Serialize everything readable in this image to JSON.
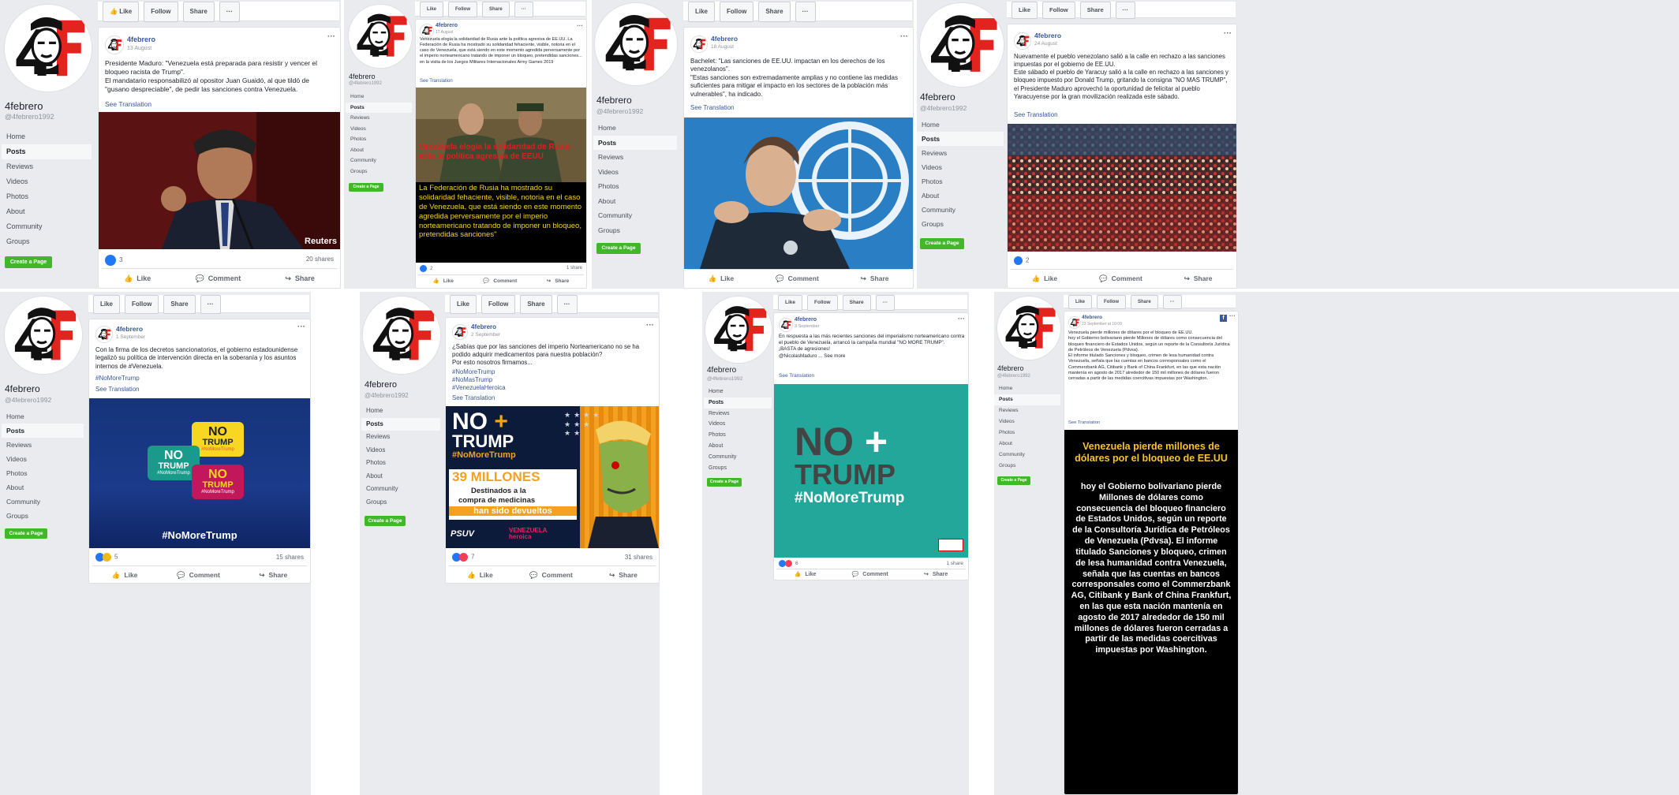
{
  "page": {
    "name": "4febrero",
    "handle": "@4febrero1992",
    "logo_text": "4F"
  },
  "toolbar": {
    "like": "Like",
    "follow": "Follow",
    "share": "Share",
    "more": "···"
  },
  "nav": [
    "Home",
    "Posts",
    "Reviews",
    "Videos",
    "Photos",
    "About",
    "Community",
    "Groups"
  ],
  "create_page": "Create a Page",
  "actions": {
    "like": "Like",
    "comment": "Comment",
    "share": "Share"
  },
  "posts": [
    {
      "author": "4febrero",
      "date": "13 August",
      "text": "Presidente Maduro: \"Venezuela está preparada para resistir y vencer el bloqueo racista de Trump\".\nEl mandatario responsabilizó al opositor Juan Guaidó, al que tildó de \"gusano despreciable\", de pedir las sanciones contra Venezuela.",
      "see_translation": "See Translation",
      "image_credit": "Reuters",
      "reactions": "3",
      "shares": "20 shares"
    },
    {
      "author": "4febrero",
      "date": "17 August",
      "text": "Venezuela elogia la solidaridad de Rusia ante la política agresiva de EE.UU. La Federación de Rusia ha mostrado su solidaridad fehaciente, visible, notoria en el caso de Venezuela, que está siendo en este momento agredida perversamente por el imperio norteamericano tratando de imponer un bloqueo, pretendidas sanciones... en la visita de los Juegos Militares Internacionales Army Games 2019",
      "see_translation": "See Translation",
      "image_title": "Venezuela elogia la solidaridad de Rusia ante la política agresiva de EEUU",
      "image_body": "La Federación de Rusia ha mostrado su solidaridad fehaciente, visible, notoria en el caso de Venezuela, que está siendo en este momento agredida perversamente por el imperio norteamericano tratando de imponer un bloqueo, pretendidas sanciones\"",
      "reactions": "2",
      "shares": "1 share"
    },
    {
      "author": "4febrero",
      "date": "18 August",
      "text": "Bachelet: \"Las sanciones de EE.UU. impactan en los derechos de los venezolanos\".\n\"Estas sanciones son extremadamente amplias y no contiene las medidas suficientes para mitigar el impacto en los sectores de la población más vulnerables\", ha indicado.",
      "see_translation": "See Translation"
    },
    {
      "author": "4febrero",
      "date": "24 August",
      "text": "Nuevamente el pueblo venezolano salió a la calle en rechazo a las sanciones impuestas por el gobierno de EE.UU.\nEste sábado el pueblo de Yaracuy salió a la calle en rechazo a las sanciones y bloqueo impuesto por Donald Trump, gritando la consigna \"NO MAS TRUMP\", el Presidente Maduro aprovechó la oportunidad de felicitar al pueblo Yaracuyense por la gran movilización realizada este sábado.",
      "see_translation": "See Translation",
      "reactions": "2"
    },
    {
      "author": "4febrero",
      "date": "1 September",
      "text": "Con la firma de los decretos sancionatorios, el gobierno estadounidense legalizó su política de intervención directa en la soberanía y los asuntos internos de #Venezuela.",
      "hashtag": "#NoMoreTrump",
      "see_translation": "See Translation",
      "image_tag": "#NoMoreTrump",
      "bubble_no": "NO",
      "bubble_trump": "TRUMP",
      "bubble_tag": "#NoMoreTrump",
      "reactions": "5",
      "shares": "15 shares"
    },
    {
      "author": "4febrero",
      "date": "2 September",
      "text": "¿Sabías que por las sanciones del imperio Norteamericano no se ha podido adquirir medicamentos para nuestra población?\nPor esto nosotros firmamos...",
      "hashtags": [
        "#NoMoreTrump",
        "#NoMasTrump",
        "#VenezuelaHeroica"
      ],
      "see_translation": "See Translation",
      "img_no": "NO",
      "img_trump": "TRUMP",
      "img_tag": "#NoMoreTrump",
      "img_millones": "39 MILLONES",
      "img_dest1": "Destinados a la",
      "img_dest2": "compra de medicinas",
      "img_devueltos": "han sido devueltos",
      "img_psuv": "PSUV",
      "img_vh": "VENEZUELA heroica",
      "reactions": "7",
      "shares": "31 shares"
    },
    {
      "author": "4febrero",
      "date": "3 September",
      "text": "En respuesta a las más recientes sanciones del imperialismo norteamericano contra el pueblo de Venezuela, arrancó la campaña mundial \"NO MORE TRUMP\".\n¡BASTA de agresiones!\n@NicolasMaduro ... See more",
      "see_translation": "See Translation",
      "img_no": "NO",
      "img_trump": "TRUMP",
      "img_tag": "#NoMoreTrump",
      "reactions": "6",
      "shares": "1 share"
    },
    {
      "author": "4febrero",
      "date": "23 September at 10:09",
      "text": "Venezuela pierde millones de dólares por el bloqueo de EE.UU.\nhoy el Gobierno bolivariano pierde Millones de dólares como consecuencia del bloqueo financiero de Estados Unidos, según un reporte de la Consultoría Jurídica de Petróleos de Venezuela (Pdvsa).\nEl informe titulado Sanciones y bloqueo, crimen de lesa humanidad contra Venezuela, señala que las cuentas en bancos corresponsales como el Commerzbank AG, Citibank y Bank of China Frankfurt, en las que esta nación mantenía en agosto de 2017 alrededor de 150 mil millones de dólares fueron cerradas a partir de las medidas coercitivas impuestas por Washington.",
      "see_translation": "See Translation",
      "img_title": "Venezuela pierde millones de dólares por el bloqueo de EE.UU",
      "img_body": "hoy el Gobierno bolivariano pierde Millones de dólares como consecuencia del bloqueo financiero de Estados Unidos, según un reporte de la Consultoría Jurídica de Petróleos de Venezuela (Pdvsa). El informe titulado Sanciones y bloqueo, crimen de lesa humanidad contra Venezuela, señala que las cuentas en bancos corresponsales como el Commerzbank AG, Citibank y Bank of China Frankfurt, en las que esta nación mantenía en agosto de 2017 alrededor de 150 mil millones de dólares fueron cerradas a partir de las medidas coercitivas impuestas por Washington."
    }
  ]
}
